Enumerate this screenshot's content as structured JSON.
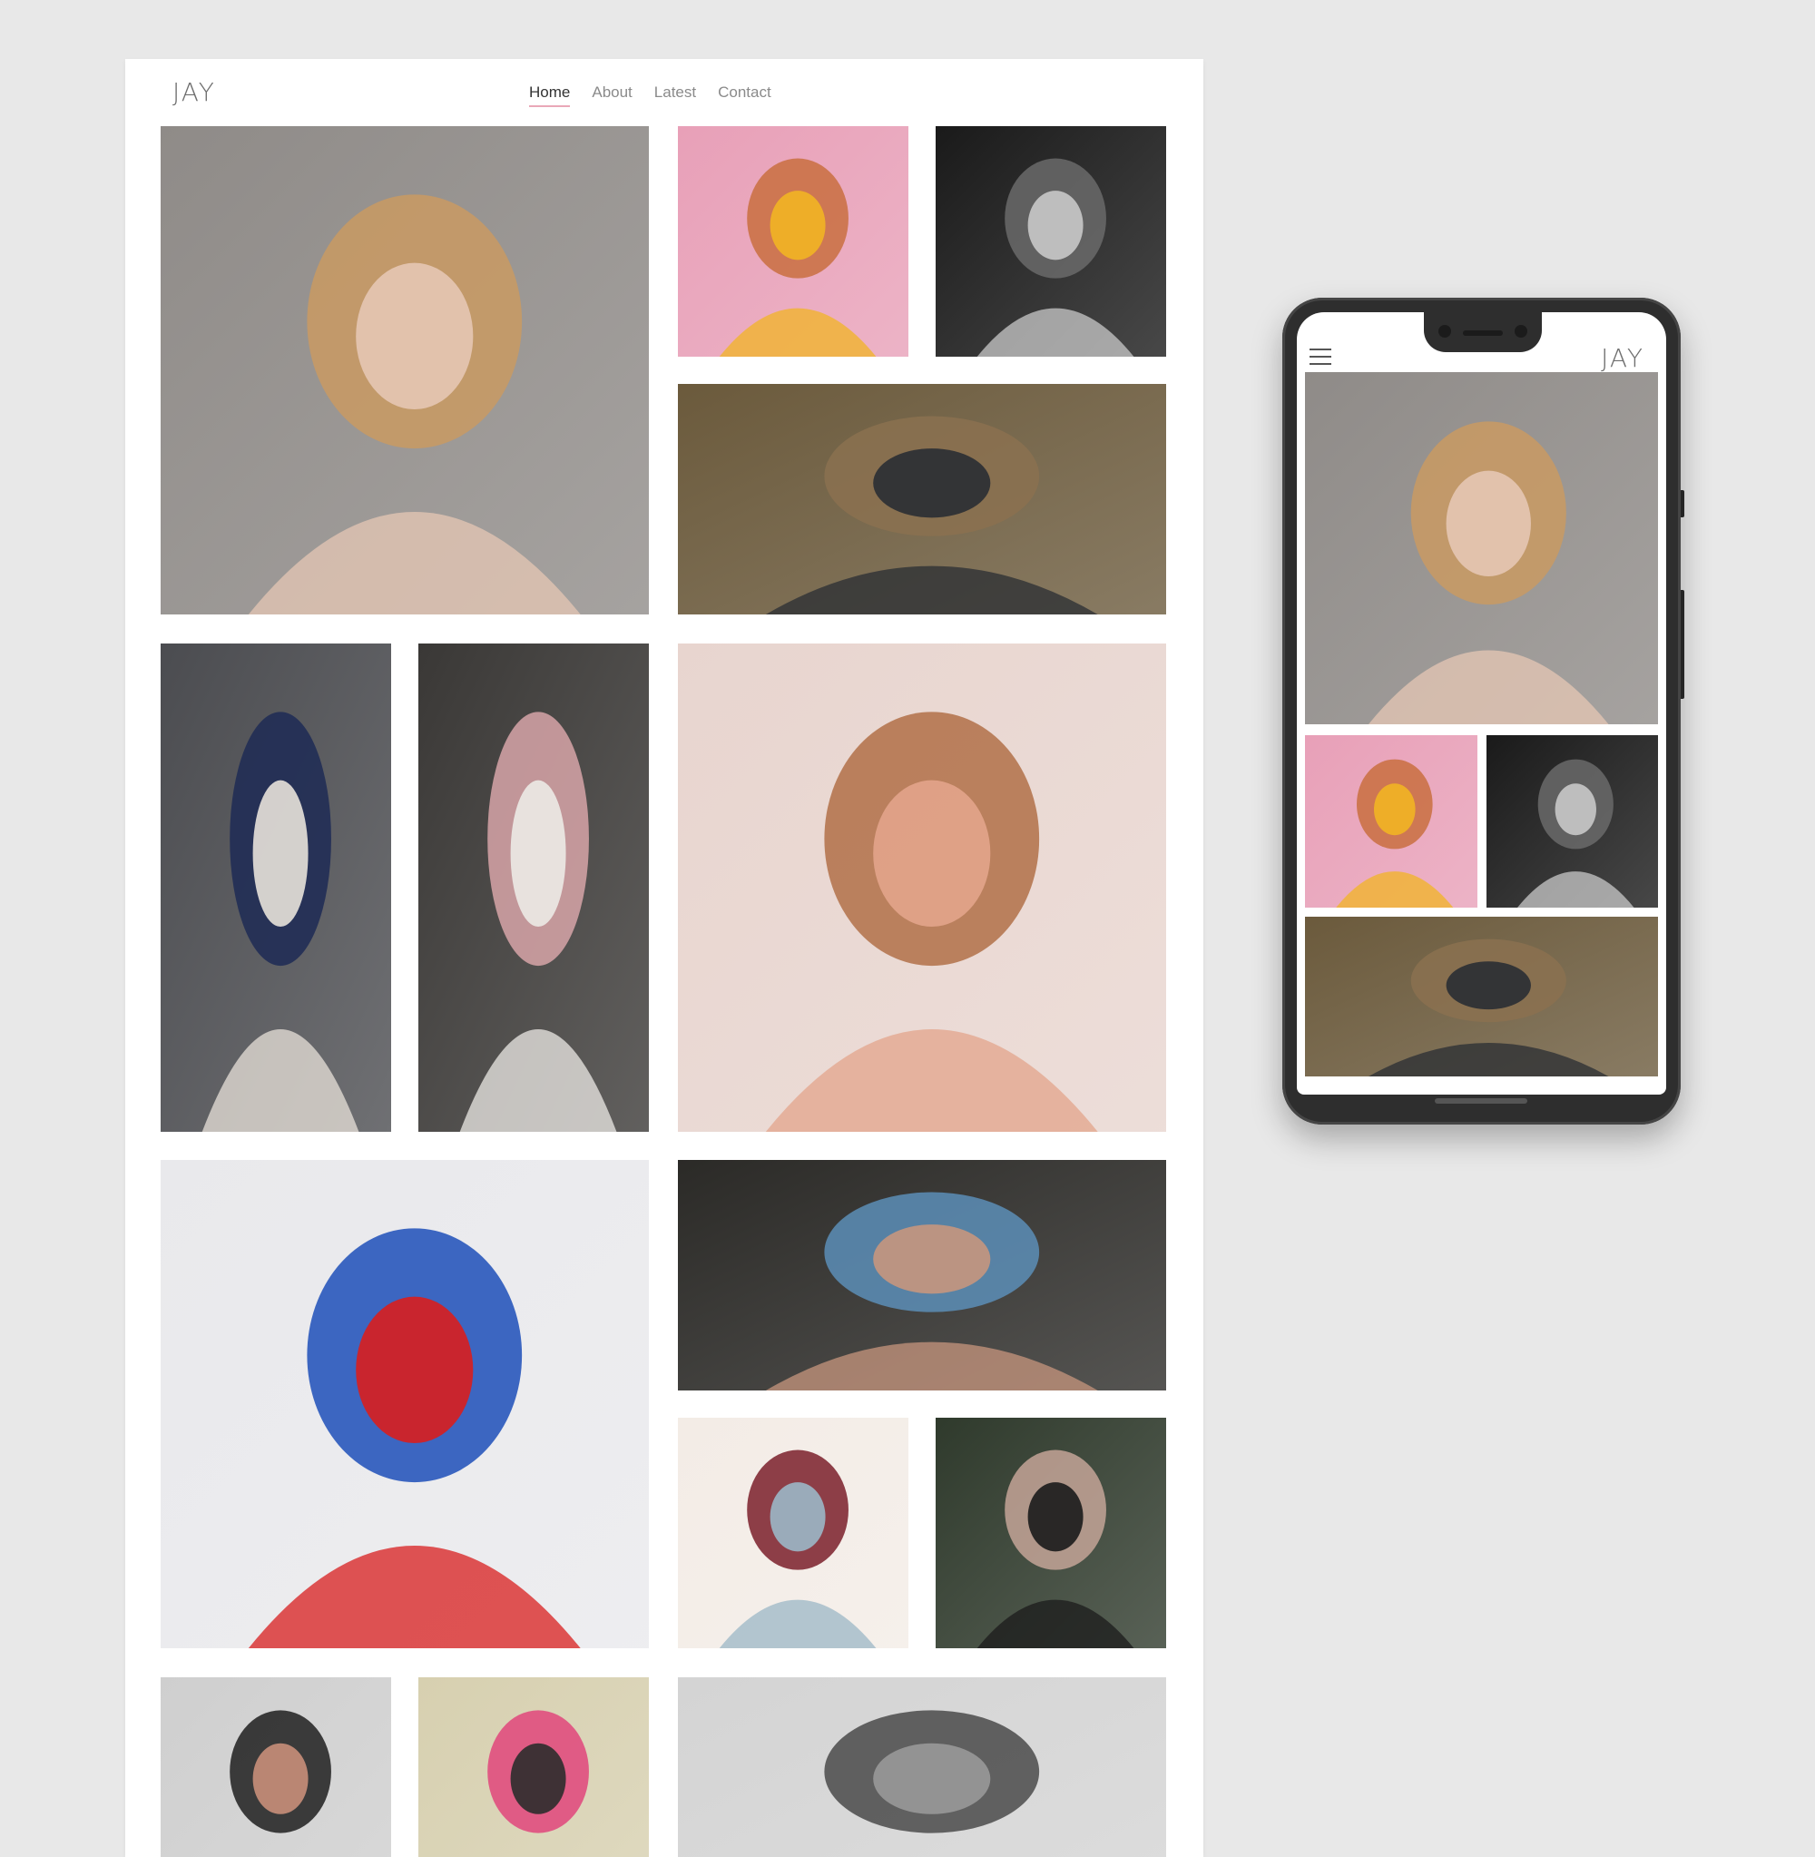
{
  "site": {
    "logo": "JAY",
    "nav": [
      {
        "label": "Home",
        "active": true
      },
      {
        "label": "About",
        "active": false
      },
      {
        "label": "Latest",
        "active": false
      },
      {
        "label": "Contact",
        "active": false
      }
    ]
  },
  "gallery": [
    {
      "id": "portrait-grey-backdrop",
      "palette": [
        "#8f8b88",
        "#c99a63",
        "#e6c7b4"
      ]
    },
    {
      "id": "orange-hat-yellow-dress",
      "palette": [
        "#e8a0b8",
        "#c96e3f",
        "#f2b424"
      ]
    },
    {
      "id": "black-white-portrait",
      "palette": [
        "#1a1a1a",
        "#6a6a6a",
        "#c9c9c9"
      ]
    },
    {
      "id": "woods-car",
      "palette": [
        "#6b5a3c",
        "#8b7150",
        "#2a2d33"
      ]
    },
    {
      "id": "full-length-studio",
      "palette": [
        "#4b4c50",
        "#1d2a55",
        "#e8e2da"
      ]
    },
    {
      "id": "waterfall-pink-bodysuit",
      "palette": [
        "#3a3836",
        "#d7a4a8",
        "#eceae6"
      ]
    },
    {
      "id": "sunlit-closeup",
      "palette": [
        "#e8d5cf",
        "#b27048",
        "#e3a48b"
      ]
    },
    {
      "id": "studio-duo-blue-red",
      "palette": [
        "#e9e9ec",
        "#1d4fb8",
        "#d81e1e"
      ]
    },
    {
      "id": "river-reclining",
      "palette": [
        "#2b2a27",
        "#5c8eb7",
        "#c7967e"
      ]
    },
    {
      "id": "maroon-sweater-urban",
      "palette": [
        "#f3ece6",
        "#7a1f2a",
        "#9bb7c6"
      ]
    },
    {
      "id": "forest-lace-bralette",
      "palette": [
        "#2f3a2c",
        "#c4a598",
        "#1b1b1b"
      ]
    },
    {
      "id": "black-lace-sleeve",
      "palette": [
        "#cfcfcf",
        "#1e1e1e",
        "#c98f7a"
      ]
    },
    {
      "id": "colorful-off-shoulder",
      "palette": [
        "#d7d0b0",
        "#e0457b",
        "#2c2c2c"
      ]
    },
    {
      "id": "monochrome-profile",
      "palette": [
        "#d4d4d4",
        "#4a4a4a",
        "#999999"
      ]
    }
  ],
  "mobile": {
    "logo": "JAY"
  }
}
